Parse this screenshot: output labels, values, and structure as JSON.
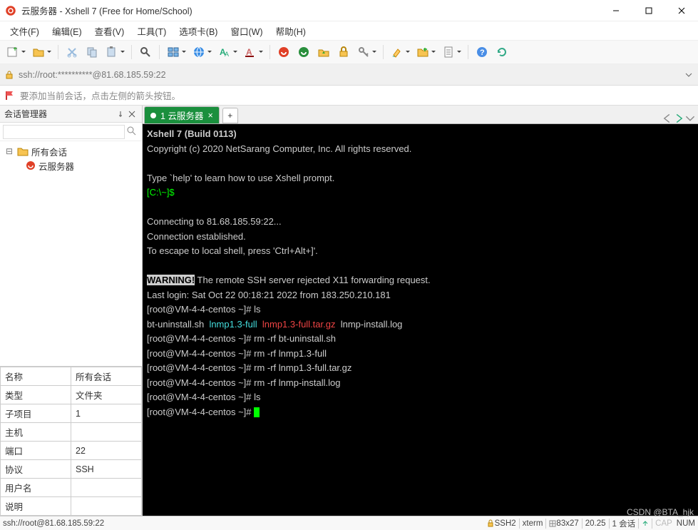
{
  "window": {
    "title": "云服务器 - Xshell 7 (Free for Home/School)"
  },
  "menu": [
    "文件(F)",
    "编辑(E)",
    "查看(V)",
    "工具(T)",
    "选项卡(B)",
    "窗口(W)",
    "帮助(H)"
  ],
  "address": "ssh://root:**********@81.68.185.59:22",
  "hint": "要添加当前会话，点击左侧的箭头按钮。",
  "sidebar": {
    "title": "会话管理器",
    "search_placeholder": "",
    "tree": {
      "root": "所有会话",
      "child": "云服务器"
    },
    "props": [
      [
        "名称",
        "所有会话"
      ],
      [
        "类型",
        "文件夹"
      ],
      [
        "子项目",
        "1"
      ],
      [
        "主机",
        ""
      ],
      [
        "端口",
        "22"
      ],
      [
        "协议",
        "SSH"
      ],
      [
        "用户名",
        ""
      ],
      [
        "说明",
        ""
      ]
    ]
  },
  "tabs": {
    "active": "1 云服务器"
  },
  "terminal": {
    "l1": "Xshell 7 (Build 0113)",
    "l2": "Copyright (c) 2020 NetSarang Computer, Inc. All rights reserved.",
    "l3": "",
    "l4": "Type `help' to learn how to use Xshell prompt.",
    "prompt_local": "[C:\\~]$ ",
    "l6": "",
    "l7": "Connecting to 81.68.185.59:22...",
    "l8": "Connection established.",
    "l9": "To escape to local shell, press 'Ctrl+Alt+]'.",
    "l10": "",
    "warn": "WARNING!",
    "warn_rest": " The remote SSH server rejected X11 forwarding request.",
    "l12": "Last login: Sat Oct 22 00:18:21 2022 from 183.250.210.181",
    "p1": "[root@VM-4-4-centos ~]# ",
    "c1": "ls",
    "ls_a": "bt-uninstall.sh  ",
    "ls_b": "lnmp1.3-full",
    "ls_b2": "  ",
    "ls_c": "lnmp1.3-full.tar.gz",
    "ls_c2": "  lnmp-install.log",
    "c2": "rm -rf bt-uninstall.sh",
    "c3": "rm -rf lnmp1.3-full",
    "c4": "rm -rf lnmp1.3-full.tar.gz",
    "c5": "rm -rf lnmp-install.log",
    "c6": "ls"
  },
  "status": {
    "left": "ssh://root@81.68.185.59:22",
    "proto": "SSH2",
    "term": "xterm",
    "size": "83x27",
    "speed": "20.25",
    "sess": "1 会话",
    "cap": "CAP",
    "num": "NUM"
  },
  "watermark": "CSDN @BTA_hjk"
}
